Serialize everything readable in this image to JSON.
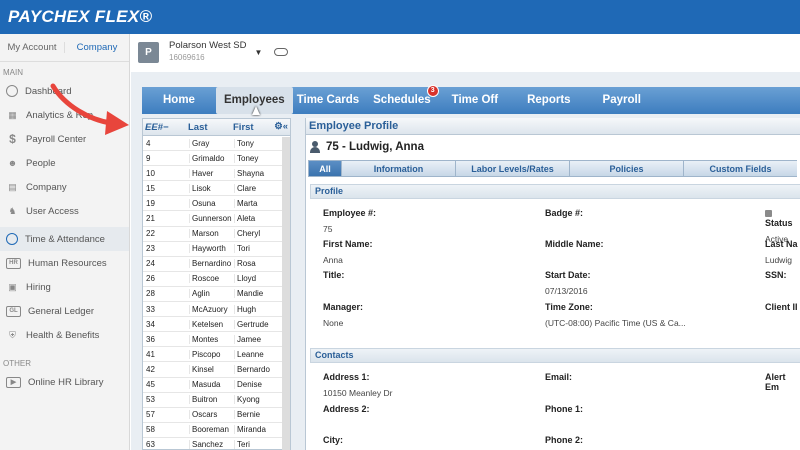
{
  "app": {
    "logo": "PAYCHEX FLEX®"
  },
  "sidebar": {
    "tabs": [
      "My Account",
      "Company"
    ],
    "sections": {
      "main": "MAIN",
      "other": "OTHER"
    },
    "items": [
      {
        "label": "Dashboard",
        "icon": "speedometer-icon"
      },
      {
        "label": "Analytics & Rep",
        "icon": "chart-icon"
      },
      {
        "label": "Payroll Center",
        "icon": "dollar-icon"
      },
      {
        "label": "People",
        "icon": "people-icon"
      },
      {
        "label": "Company",
        "icon": "building-icon"
      },
      {
        "label": "User Access",
        "icon": "user-access-icon"
      },
      {
        "label": "Time & Attendance",
        "icon": "clock-icon"
      },
      {
        "label": "Human Resources",
        "icon": "hr-icon"
      },
      {
        "label": "Hiring",
        "icon": "hiring-icon"
      },
      {
        "label": "General Ledger",
        "icon": "gl-icon"
      },
      {
        "label": "Health & Benefits",
        "icon": "shield-icon"
      },
      {
        "label": "Online HR Library",
        "icon": "play-icon"
      }
    ]
  },
  "company": {
    "badge": "P",
    "name": "Polarson West SD",
    "id": "16069616"
  },
  "nav": {
    "items": [
      "Home",
      "Employees",
      "Time Cards",
      "Schedules",
      "Time Off",
      "Reports",
      "Payroll"
    ],
    "schedules_badge": "3",
    "active": "Employees"
  },
  "employee_list": {
    "headers": [
      "EE#−",
      "Last",
      "First"
    ],
    "rows": [
      [
        "4",
        "Gray",
        "Tony"
      ],
      [
        "9",
        "Grimaldo",
        "Toney"
      ],
      [
        "10",
        "Haver",
        "Shayna"
      ],
      [
        "15",
        "Lisok",
        "Clare"
      ],
      [
        "19",
        "Osuna",
        "Marta"
      ],
      [
        "21",
        "Gunnerson",
        "Aleta"
      ],
      [
        "22",
        "Marson",
        "Cheryl"
      ],
      [
        "23",
        "Hayworth",
        "Tori"
      ],
      [
        "24",
        "Bernardino",
        "Rosa"
      ],
      [
        "26",
        "Roscoe",
        "Lloyd"
      ],
      [
        "28",
        "Aglin",
        "Mandie"
      ],
      [
        "33",
        "McAzuory",
        "Hugh"
      ],
      [
        "34",
        "Ketelsen",
        "Gertrude"
      ],
      [
        "36",
        "Montes",
        "Jamee"
      ],
      [
        "41",
        "Piscopo",
        "Leanne"
      ],
      [
        "42",
        "Kinsel",
        "Bernardo"
      ],
      [
        "45",
        "Masuda",
        "Denise"
      ],
      [
        "53",
        "Buitron",
        "Kyong"
      ],
      [
        "57",
        "Oscars",
        "Bernie"
      ],
      [
        "58",
        "Booreman",
        "Miranda"
      ],
      [
        "63",
        "Sanchez",
        "Teri"
      ]
    ]
  },
  "profile": {
    "title": "Employee Profile",
    "employee_header": "75 - Ludwig, Anna",
    "tabs": [
      "All",
      "Information",
      "Labor Levels/Rates",
      "Policies",
      "Custom Fields"
    ],
    "active_tab": "All",
    "profile_section": "Profile",
    "contacts_section": "Contacts",
    "fields": {
      "employee_num": {
        "label": "Employee #:",
        "value": "75"
      },
      "badge_num": {
        "label": "Badge #:",
        "value": ""
      },
      "status": {
        "label": "Status",
        "value": "Active"
      },
      "first_name": {
        "label": "First Name:",
        "value": "Anna"
      },
      "middle_name": {
        "label": "Middle Name:",
        "value": ""
      },
      "last_name": {
        "label": "Last Na",
        "value": "Ludwig"
      },
      "title": {
        "label": "Title:",
        "value": ""
      },
      "start_date": {
        "label": "Start Date:",
        "value": "07/13/2016"
      },
      "ssn": {
        "label": "SSN:",
        "value": ""
      },
      "manager": {
        "label": "Manager:",
        "value": "None"
      },
      "time_zone": {
        "label": "Time Zone:",
        "value": "(UTC-08:00) Pacific Time (US & Ca..."
      },
      "client_id": {
        "label": "Client II",
        "value": ""
      },
      "address1": {
        "label": "Address 1:",
        "value": "10150 Meanley Dr"
      },
      "email": {
        "label": "Email:",
        "value": ""
      },
      "alert_email": {
        "label": "Alert Em",
        "value": ""
      },
      "address2": {
        "label": "Address 2:",
        "value": ""
      },
      "phone1": {
        "label": "Phone 1:",
        "value": ""
      },
      "city": {
        "label": "City:",
        "value": ""
      },
      "phone2": {
        "label": "Phone 2:",
        "value": ""
      }
    }
  },
  "colors": {
    "brand_blue": "#1f69b6",
    "nav_blue": "#3d7dbf",
    "badge_red": "#d9332c",
    "arrow_red": "#e8453c"
  }
}
